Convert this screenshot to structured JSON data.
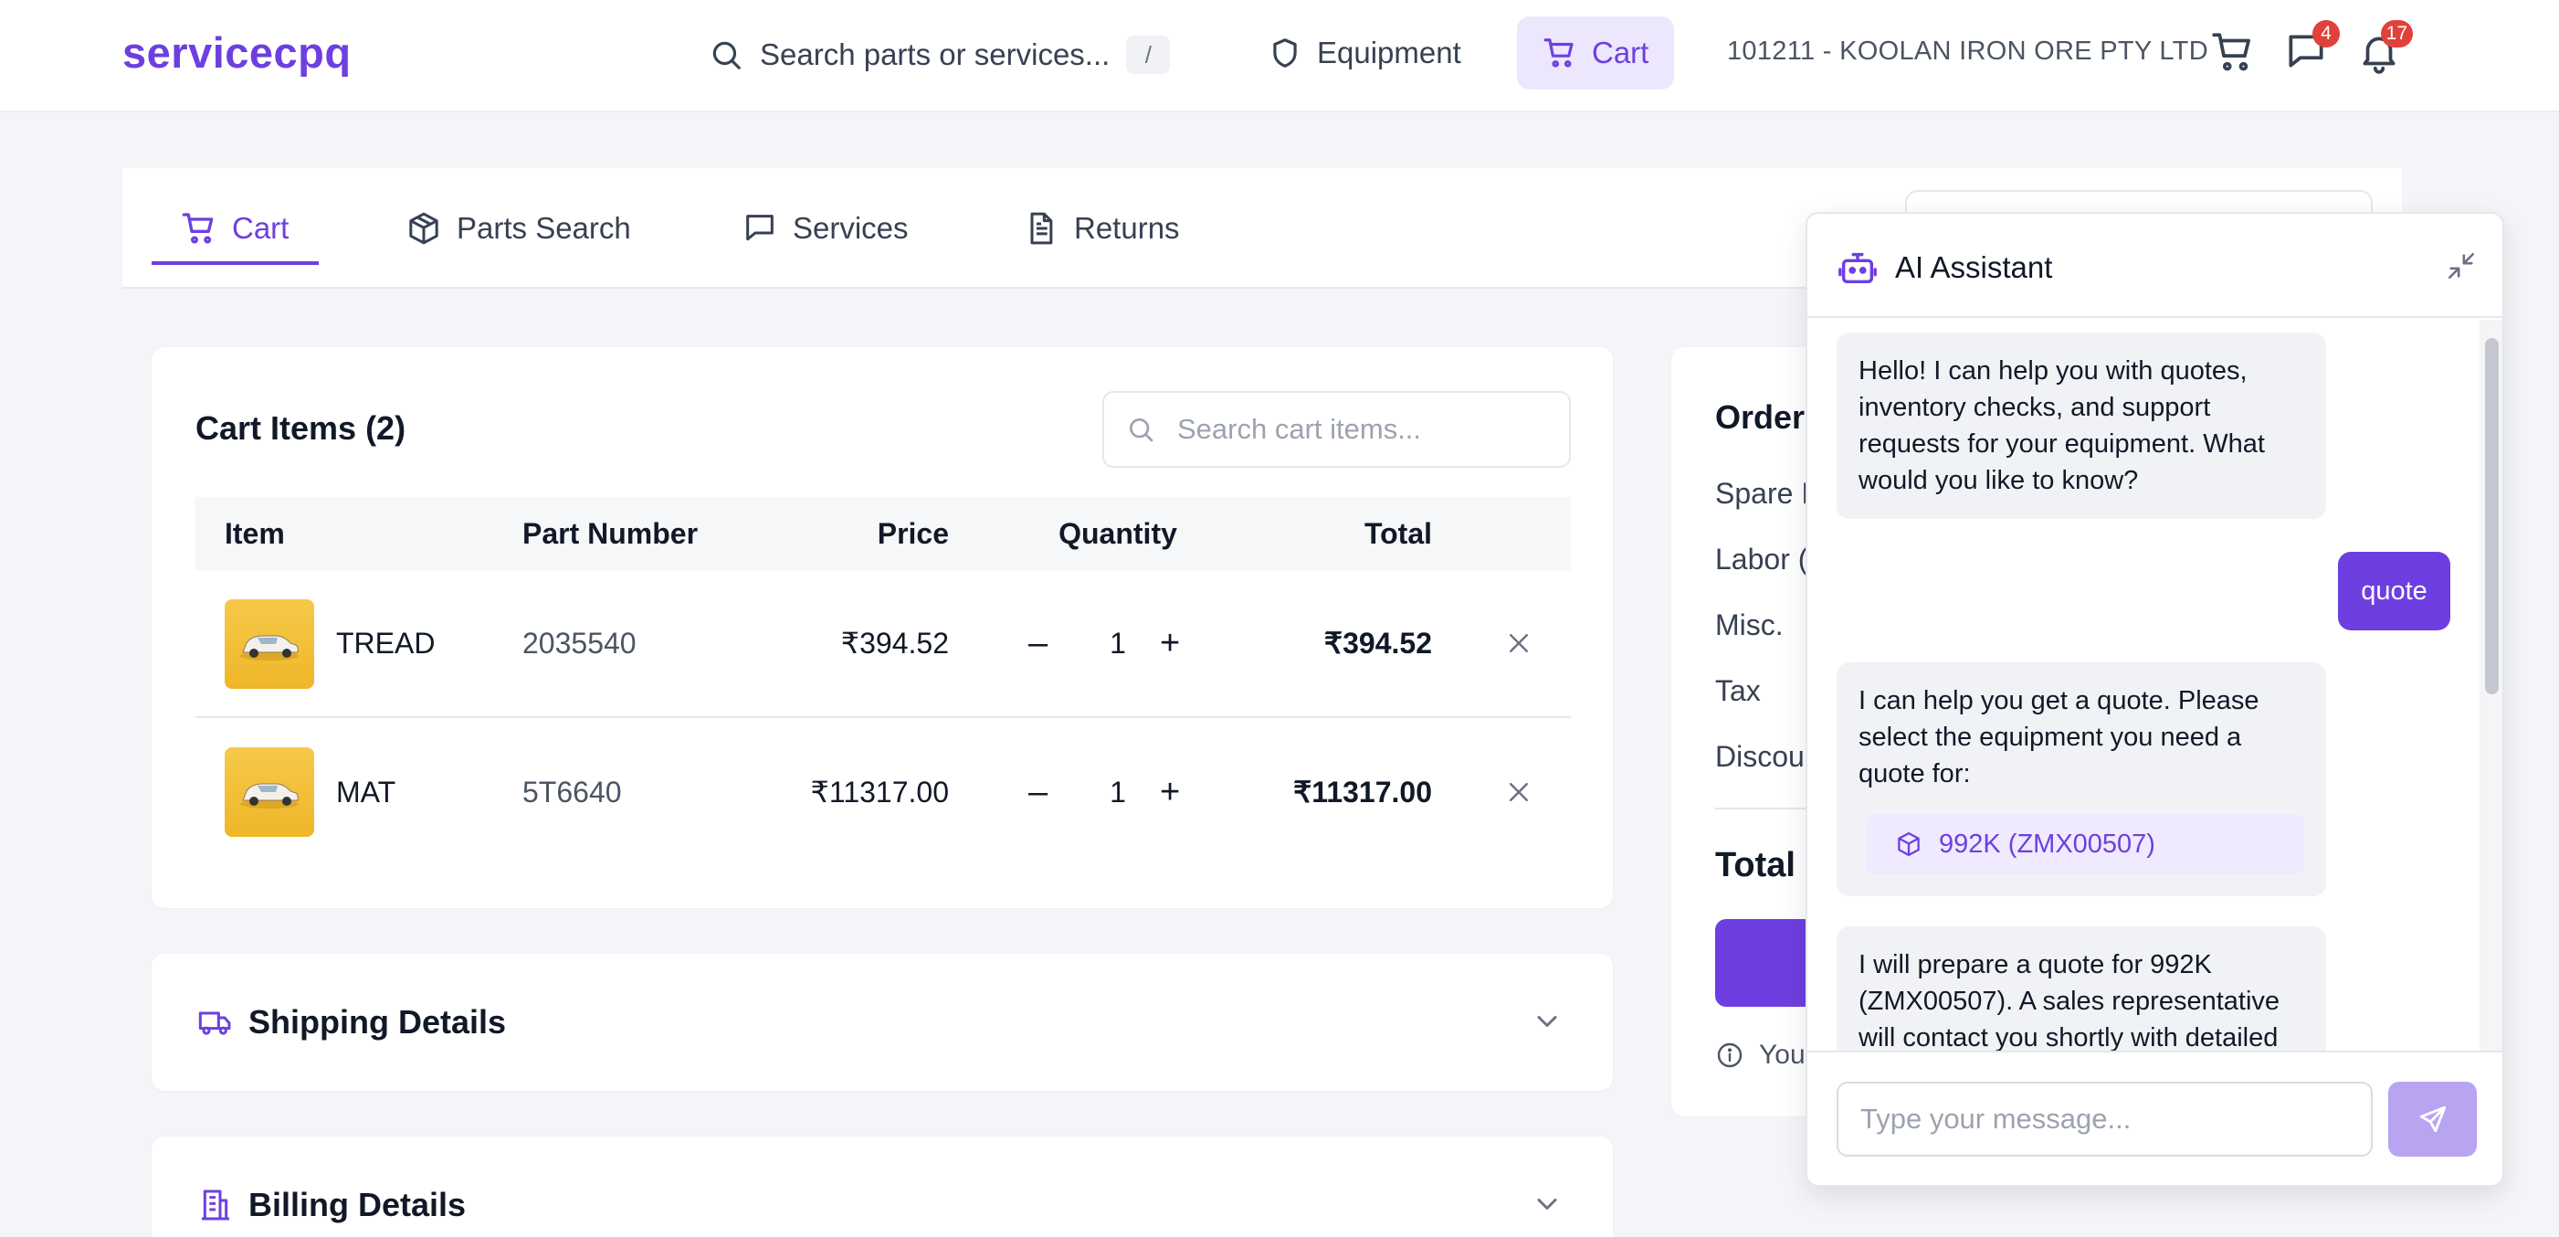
{
  "topbar": {
    "logo": "servicecpq",
    "search_placeholder": "Search parts or services...",
    "search_shortcut": "/",
    "nav": [
      {
        "label": "Equipment",
        "icon": "shield-icon"
      },
      {
        "label": "Cart",
        "icon": "cart-icon",
        "active": true
      }
    ],
    "account": "101211 - KOOLAN IRON ORE PTY LTD",
    "messages_badge": "4",
    "notifications_badge": "17"
  },
  "tabs": [
    {
      "label": "Cart",
      "icon": "cart-icon",
      "active": true
    },
    {
      "label": "Parts Search",
      "icon": "box-icon"
    },
    {
      "label": "Services",
      "icon": "message-square-icon"
    },
    {
      "label": "Returns",
      "icon": "document-icon"
    }
  ],
  "cart": {
    "title": "Cart Items (2)",
    "search_placeholder": "Search cart items...",
    "columns": {
      "item": "Item",
      "part_number": "Part Number",
      "price": "Price",
      "quantity": "Quantity",
      "total": "Total"
    },
    "rows": [
      {
        "name": "TREAD",
        "part_number": "2035540",
        "price": "₹394.52",
        "quantity": "1",
        "total": "₹394.52"
      },
      {
        "name": "MAT",
        "part_number": "5T6640",
        "price": "₹11317.00",
        "quantity": "1",
        "total": "₹11317.00"
      }
    ],
    "minus": "–",
    "plus": "+"
  },
  "sections": {
    "shipping": "Shipping Details",
    "billing": "Billing Details"
  },
  "summary": {
    "title": "Order",
    "rows": [
      "Spare I",
      "Labor (",
      "Misc.",
      "Tax",
      "Discou"
    ],
    "total": "Total",
    "note": "You"
  },
  "assistant": {
    "title": "AI Assistant",
    "messages": {
      "greeting": "Hello! I can help you with quotes, inventory checks, and support requests for your equipment. What would you like to know?",
      "user": "quote",
      "select": "I can help you get a quote. Please select the equipment you need a quote for:",
      "equipment": "992K (ZMX00507)",
      "prepare": "I will prepare a quote for 992K (ZMX00507). A sales representative will contact you shortly with detailed"
    },
    "input_placeholder": "Type your message..."
  },
  "colors": {
    "accent": "#6d3fe0",
    "badge": "#e0413a",
    "accent_light": "#ede7fd"
  }
}
